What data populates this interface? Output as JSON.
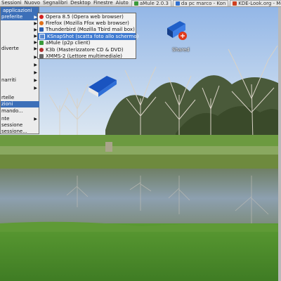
{
  "taskbar": {
    "menus": [
      "Sessioni",
      "Nuovo",
      "Segnalibri",
      "Desktop",
      "Finestre",
      "Aiuto"
    ],
    "tasks": [
      {
        "label": "aMule 2.0.3",
        "icon": "amule-icon",
        "color": "#3a9a3a"
      },
      {
        "label": "da pc marco - Kon",
        "icon": "konqueror-icon",
        "color": "#2f6fd0"
      },
      {
        "label": "KDE-Look.org - Mo",
        "icon": "browser-icon",
        "color": "#d04020"
      }
    ]
  },
  "kmenu": {
    "header": "applicazioni",
    "items": [
      {
        "label": "preferite",
        "selected": true,
        "submenu": true
      },
      {
        "label": "",
        "submenu": true
      },
      {
        "label": "",
        "submenu": true
      },
      {
        "label": "",
        "submenu": true
      },
      {
        "label": "",
        "submenu": true
      },
      {
        "label": "diverte",
        "submenu": true
      },
      {
        "label": "",
        "submenu": true
      },
      {
        "label": "",
        "submenu": true
      },
      {
        "label": "",
        "submenu": true
      },
      {
        "label": "narriti",
        "submenu": true
      },
      {
        "label": "",
        "submenu": true
      },
      {
        "label": "",
        "submenu": true
      },
      {
        "label": "rtelle",
        "submenu": false
      },
      {
        "label": "zioni",
        "submenu": false,
        "selected": true
      },
      {
        "label": "mando...",
        "submenu": false
      },
      {
        "label": "",
        "submenu": false
      },
      {
        "label": "nte",
        "submenu": true
      },
      {
        "label": "sessione",
        "submenu": false
      },
      {
        "label": "sessione...",
        "submenu": false
      }
    ]
  },
  "submenu": {
    "items": [
      {
        "label": "Opera 8.5 (Opera web browser)",
        "icon": "opera-icon",
        "color": "#d42020"
      },
      {
        "label": "Firefox (Mozilla Ffox web browser)",
        "icon": "firefox-icon",
        "color": "#e0701a"
      },
      {
        "label": "Thunderbird (Mozilla Tbird mail box)",
        "icon": "thunderbird-icon",
        "color": "#2c5fb0"
      },
      {
        "label": "KSnapShot (scatta foto allo schermo)",
        "icon": "ksnapshot-icon",
        "color": "#5a8ad0",
        "selected": true
      },
      {
        "label": "aMule (p2p client)",
        "icon": "amule-icon",
        "color": "#3a9a3a"
      },
      {
        "label": "K3b (Masterizzatore CD & DVD)",
        "icon": "k3b-icon",
        "color": "#b03030"
      },
      {
        "label": "XMMS-2 (Lettore multimediale)",
        "icon": "xmms-icon",
        "color": "#666666"
      }
    ]
  },
  "desktop": {
    "icons": [
      {
        "label": "Shared",
        "name": "shared-folder-icon"
      },
      {
        "label": "",
        "name": "book-icon"
      }
    ]
  },
  "colors": {
    "highlight": "#3c6fb8",
    "sky": "#a8c8ec",
    "grass": "#4a8a2a",
    "water": "#7c8c7a"
  }
}
